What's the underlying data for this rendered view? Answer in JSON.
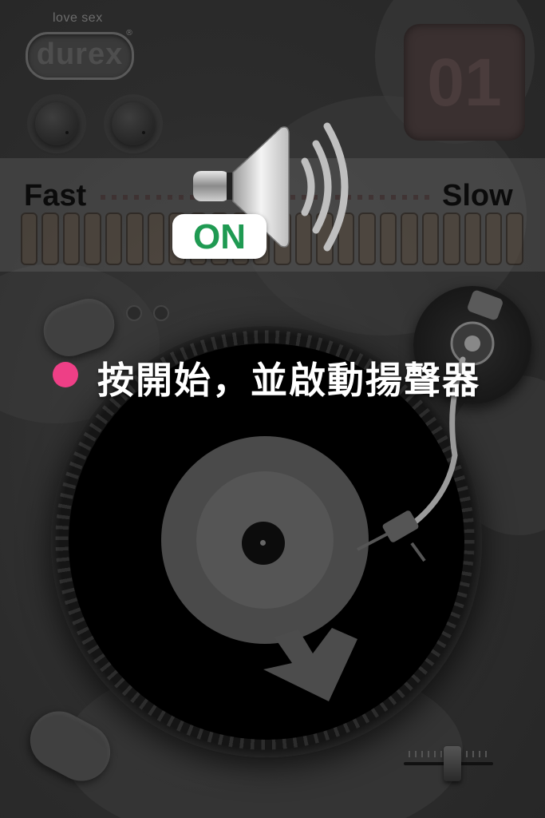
{
  "brand": {
    "tagline": "love sex",
    "logo_text": "durex",
    "registered_mark": "®"
  },
  "deck": {
    "number": "01"
  },
  "speed": {
    "fast_label": "Fast",
    "slow_label": "Slow",
    "slot_count": 24
  },
  "speaker": {
    "status": "ON",
    "icon": "speaker-icon"
  },
  "instruction": {
    "text": "按開始，並啟動揚聲器",
    "bullet_color": "#ee3f86"
  },
  "colors": {
    "on_text": "#1f9a52",
    "bullet": "#ee3f86"
  }
}
